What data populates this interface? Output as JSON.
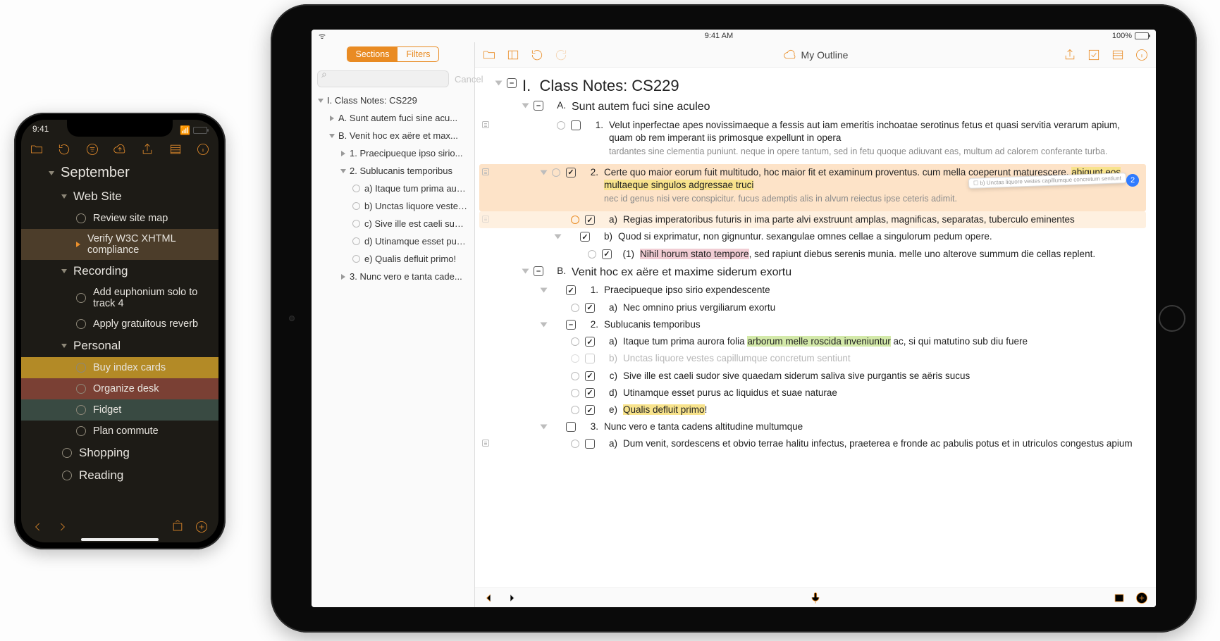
{
  "iphone": {
    "status_time": "9:41",
    "title": "September",
    "rows": [
      {
        "lvl": 1,
        "type": "tri-open",
        "text": "Web Site"
      },
      {
        "lvl": 2,
        "type": "circ",
        "text": "Review site map"
      },
      {
        "lvl": 2,
        "type": "tri-sel",
        "text": "Verify W3C XHTML compliance",
        "sel": true
      },
      {
        "lvl": 1,
        "type": "tri-open",
        "text": "Recording"
      },
      {
        "lvl": 2,
        "type": "circ",
        "text": "Add euphonium solo to track 4"
      },
      {
        "lvl": 2,
        "type": "circ",
        "text": "Apply gratuitous reverb"
      },
      {
        "lvl": 1,
        "type": "tri-open",
        "text": "Personal"
      },
      {
        "lvl": 2,
        "type": "circ",
        "text": "Buy index cards",
        "hl": "hl-yellow"
      },
      {
        "lvl": 2,
        "type": "circ",
        "text": "Organize desk",
        "hl": "hl-red"
      },
      {
        "lvl": 2,
        "type": "circ",
        "text": "Fidget",
        "hl": "hl-teal"
      },
      {
        "lvl": 2,
        "type": "circ",
        "text": "Plan commute"
      },
      {
        "lvl": 1,
        "type": "circ",
        "text": "Shopping"
      },
      {
        "lvl": 1,
        "type": "circ",
        "text": "Reading"
      }
    ]
  },
  "ipad": {
    "status_time": "9:41 AM",
    "battery": "100%",
    "seg_a": "Sections",
    "seg_b": "Filters",
    "search_cancel": "Cancel",
    "doc_title": "My Outline",
    "sidebar": [
      {
        "i": 0,
        "tri": "open",
        "text": "I.  Class Notes: CS229"
      },
      {
        "i": 1,
        "tri": "closed",
        "text": "A.  Sunt autem fuci sine acu..."
      },
      {
        "i": 1,
        "tri": "open",
        "text": "B.  Venit hoc ex aëre et max..."
      },
      {
        "i": 2,
        "tri": "closed",
        "text": "1.  Praecipueque ipso sirio..."
      },
      {
        "i": 2,
        "tri": "open",
        "text": "2.  Sublucanis temporibus"
      },
      {
        "i": 3,
        "circ": true,
        "text": "a)  Itaque tum prima auro..."
      },
      {
        "i": 3,
        "circ": true,
        "text": "b)  Unctas liquore vestes..."
      },
      {
        "i": 3,
        "circ": true,
        "text": "c)  Sive ille est caeli sudo..."
      },
      {
        "i": 3,
        "circ": true,
        "text": "d)  Utinamque esset puru..."
      },
      {
        "i": 3,
        "circ": true,
        "text": "e)  Qualis defluit primo!"
      },
      {
        "i": 2,
        "tri": "closed",
        "text": "3.  Nunc vero e tanta cade..."
      }
    ],
    "main_title_prefix": "I.",
    "main_title": "Class Notes: CS229",
    "A": {
      "label": "A.",
      "title": "Sunt autem fuci sine aculeo",
      "r1_lab": "1.",
      "r1": "Velut inperfectae apes novissimaeque a fessis aut iam emeritis inchoatae serotinus fetus et quasi servitia verarum apium, quam ob rem imperant iis primosque expellunt in opera",
      "r1_note": "tardantes sine clementia puniunt. neque in opere tantum, sed in fetu quoque adiuvant eas, multum ad calorem conferante turba.",
      "r2_lab": "2.",
      "r2_a": "Certe quo maior eorum fuit multitudo, hoc maior fit et examinum proventus. cum mella coeperunt maturescere, ",
      "r2_b": "abigunt eos multaeque singulos adgressae truci",
      "r2_note": "nec id genus nisi vere conspicitur. fucus ademptis alis in alvum reiectus ipse ceteris adimit.",
      "a_lab": "a)",
      "a": "Regias imperatoribus futuris in ima parte alvi exstruunt amplas, magnificas, separatas, tuberculo eminentes",
      "b_lab": "b)",
      "b": "Quod si exprimatur, non gignuntur. sexangulae omnes cellae a singulorum pedum opere.",
      "b1_lab": "(1)",
      "b1_a": "Nihil horum stato tempore",
      "b1_b": ", sed rapiunt diebus serenis munia. melle uno alterove summum die cellas replent.",
      "drag_text": "b)  Unctas liquore vestes capillumque concretum sentiunt",
      "drag_count": "2"
    },
    "B": {
      "label": "B.",
      "title": "Venit hoc ex aëre et maxime siderum exortu",
      "r1_lab": "1.",
      "r1": "Praecipueque ipso sirio expendescente",
      "a_lab": "a)",
      "a": "Nec omnino prius vergiliarum exortu",
      "r2_lab": "2.",
      "r2": "Sublucanis temporibus",
      "sa_lab": "a)",
      "sa_a": "Itaque tum prima aurora folia ",
      "sa_b": "arborum melle roscida inveniuntur",
      "sa_c": " ac, si qui matutino sub diu fuere",
      "sb_lab": "b)",
      "sb": "Unctas liquore vestes capillumque concretum sentiunt",
      "sc_lab": "c)",
      "sc": "Sive ille est caeli sudor sive quaedam siderum saliva sive purgantis se aëris sucus",
      "sd_lab": "d)",
      "sd": "Utinamque esset purus ac liquidus et suae naturae",
      "se_lab": "e)",
      "se": "Qualis defluit primo",
      "se_exc": "!",
      "r3_lab": "3.",
      "r3": "Nunc vero e tanta cadens altitudine multumque",
      "ta_lab": "a)",
      "ta": "Dum venit, sordescens et obvio terrae halitu infectus, praeterea e fronde ac pabulis potus et in utriculos congestus apium"
    }
  }
}
